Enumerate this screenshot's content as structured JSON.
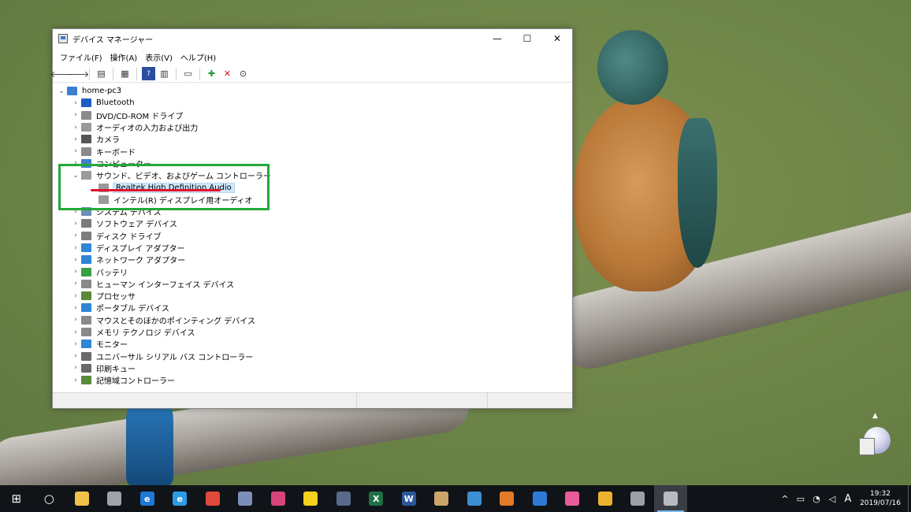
{
  "window": {
    "title": "デバイス マネージャー",
    "minimize": "—",
    "maximize": "☐",
    "close": "✕"
  },
  "menu": [
    "ファイル(F)",
    "操作(A)",
    "表示(V)",
    "ヘルプ(H)"
  ],
  "toolbar": [
    "back-icon",
    "forward-icon",
    "properties-icon",
    "view-icon",
    "help-icon",
    "details-icon",
    "monitor-scan-icon",
    "add-driver-icon",
    "uninstall-icon",
    "download-icon"
  ],
  "tree": {
    "root": "home-pc3",
    "nodes": [
      {
        "label": "Bluetooth",
        "icon": "bluetooth-icon",
        "expanded": false
      },
      {
        "label": "DVD/CD-ROM ドライブ",
        "icon": "dvd-drive-icon",
        "expanded": false
      },
      {
        "label": "オーディオの入力および出力",
        "icon": "speaker-icon",
        "expanded": false
      },
      {
        "label": "カメラ",
        "icon": "camera-icon",
        "expanded": false
      },
      {
        "label": "キーボード",
        "icon": "keyboard-icon",
        "expanded": false
      },
      {
        "label": "コンピューター",
        "icon": "computer-icon",
        "expanded": false
      },
      {
        "label": "サウンド、ビデオ、およびゲーム コントローラー",
        "icon": "speaker-icon",
        "expanded": true,
        "children": [
          {
            "label": "Realtek High Definition Audio",
            "selected": true
          },
          {
            "label": "インテル(R) ディスプレイ用オーディオ",
            "selected": false
          }
        ]
      },
      {
        "label": "システム デバイス",
        "icon": "system-device-icon",
        "expanded": false
      },
      {
        "label": "ソフトウェア デバイス",
        "icon": "software-device-icon",
        "expanded": false
      },
      {
        "label": "ディスク ドライブ",
        "icon": "disk-drive-icon",
        "expanded": false
      },
      {
        "label": "ディスプレイ アダプター",
        "icon": "display-adapter-icon",
        "expanded": false
      },
      {
        "label": "ネットワーク アダプター",
        "icon": "network-adapter-icon",
        "expanded": false
      },
      {
        "label": "バッテリ",
        "icon": "battery-icon",
        "expanded": false
      },
      {
        "label": "ヒューマン インターフェイス デバイス",
        "icon": "hid-icon",
        "expanded": false
      },
      {
        "label": "プロセッサ",
        "icon": "processor-icon",
        "expanded": false
      },
      {
        "label": "ポータブル デバイス",
        "icon": "portable-device-icon",
        "expanded": false
      },
      {
        "label": "マウスとそのほかのポインティング デバイス",
        "icon": "mouse-icon",
        "expanded": false
      },
      {
        "label": "メモリ テクノロジ デバイス",
        "icon": "memory-device-icon",
        "expanded": false
      },
      {
        "label": "モニター",
        "icon": "monitor-icon",
        "expanded": false
      },
      {
        "label": "ユニバーサル シリアル バス コントローラー",
        "icon": "usb-icon",
        "expanded": false
      },
      {
        "label": "印刷キュー",
        "icon": "printer-icon",
        "expanded": false
      },
      {
        "label": "記憶域コントローラー",
        "icon": "storage-controller-icon",
        "expanded": false
      }
    ]
  },
  "colors": {
    "highlight_box": "#23a83a",
    "underline": "#e0142b",
    "selection": "#cce8ff",
    "taskbar": "#101418"
  },
  "taskbar": {
    "apps": [
      {
        "name": "start-icon",
        "glyph": "⊞",
        "color": "#ffffff"
      },
      {
        "name": "cortana-icon",
        "glyph": "○",
        "color": "#ffffff"
      },
      {
        "name": "file-explorer-icon",
        "glyph": "",
        "color": "#f0c24a"
      },
      {
        "name": "photos-app-icon",
        "glyph": "",
        "color": "#a0a4a8"
      },
      {
        "name": "edge-icon",
        "glyph": "e",
        "color": "#1e78d6"
      },
      {
        "name": "internet-explorer-icon",
        "glyph": "e",
        "color": "#2b9ce4"
      },
      {
        "name": "chrome-icon",
        "glyph": "",
        "color": "#e04a3a"
      },
      {
        "name": "network-globe-icon",
        "glyph": "",
        "color": "#7c8fb8"
      },
      {
        "name": "paint-app-icon",
        "glyph": "",
        "color": "#d6457a"
      },
      {
        "name": "sticky-notes-icon",
        "glyph": "",
        "color": "#f2d21b"
      },
      {
        "name": "calculator-icon",
        "glyph": "",
        "color": "#5a6a8a"
      },
      {
        "name": "excel-icon",
        "glyph": "X",
        "color": "#1e7145"
      },
      {
        "name": "word-icon",
        "glyph": "W",
        "color": "#2b579a"
      },
      {
        "name": "paint3d-icon",
        "glyph": "",
        "color": "#c9a56a"
      },
      {
        "name": "control-panel-icon",
        "glyph": "",
        "color": "#3c8fd0"
      },
      {
        "name": "toolbox-icon",
        "glyph": "",
        "color": "#e27a28"
      },
      {
        "name": "remote-desktop-icon",
        "glyph": "",
        "color": "#2d7ad6"
      },
      {
        "name": "whiteboard-icon",
        "glyph": "",
        "color": "#ea5b9b"
      },
      {
        "name": "slack-icon",
        "glyph": "",
        "color": "#ecb22e"
      },
      {
        "name": "device-manager-icon",
        "glyph": "",
        "color": "#9aa0a6"
      },
      {
        "name": "device-manager-window-icon",
        "glyph": "",
        "color": "#b8bcc0",
        "active": true
      }
    ],
    "tray": {
      "chevron": "^",
      "battery": "▭",
      "wifi": "◔",
      "volume": "◁",
      "ime": "A",
      "time": "19:32",
      "date": "2019/07/16"
    }
  }
}
